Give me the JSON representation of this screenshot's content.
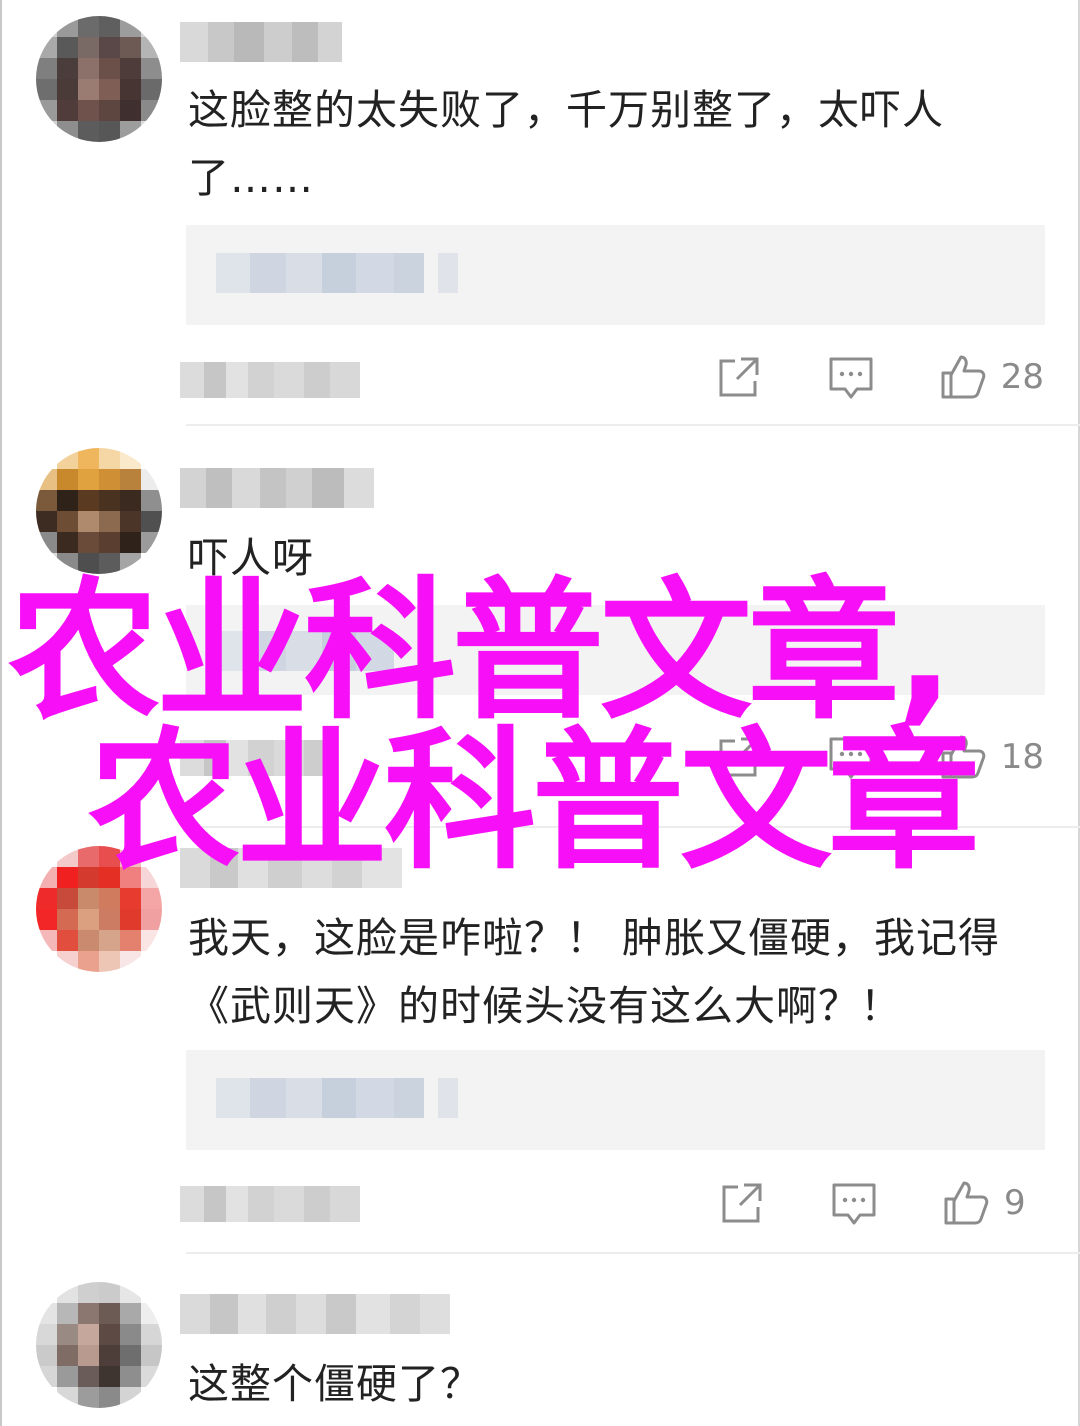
{
  "comments": [
    {
      "text_line1": "这脸整的太失败了，千万别整了，太吓人",
      "text_line2": "了……",
      "like_count": "28"
    },
    {
      "text_line1": "吓人呀",
      "like_count": "18"
    },
    {
      "text_line1": "我天，这脸是咋啦？！ 肿胀又僵硬，我记得",
      "text_line2": "《武则天》的时候头没有这么大啊？！",
      "like_count": "9"
    },
    {
      "text_line1": "这整个僵硬了？"
    }
  ],
  "overlay": {
    "line1": "农业科普文章,",
    "line2": "农业科普文章"
  },
  "colors": {
    "overlay": "#f70ff7",
    "icon_gray": "#8c8c8c",
    "reply_bg": "#f3f3f3"
  },
  "icons": {
    "share": "share-icon",
    "reply": "comment-icon",
    "like": "thumbs-up-icon"
  }
}
